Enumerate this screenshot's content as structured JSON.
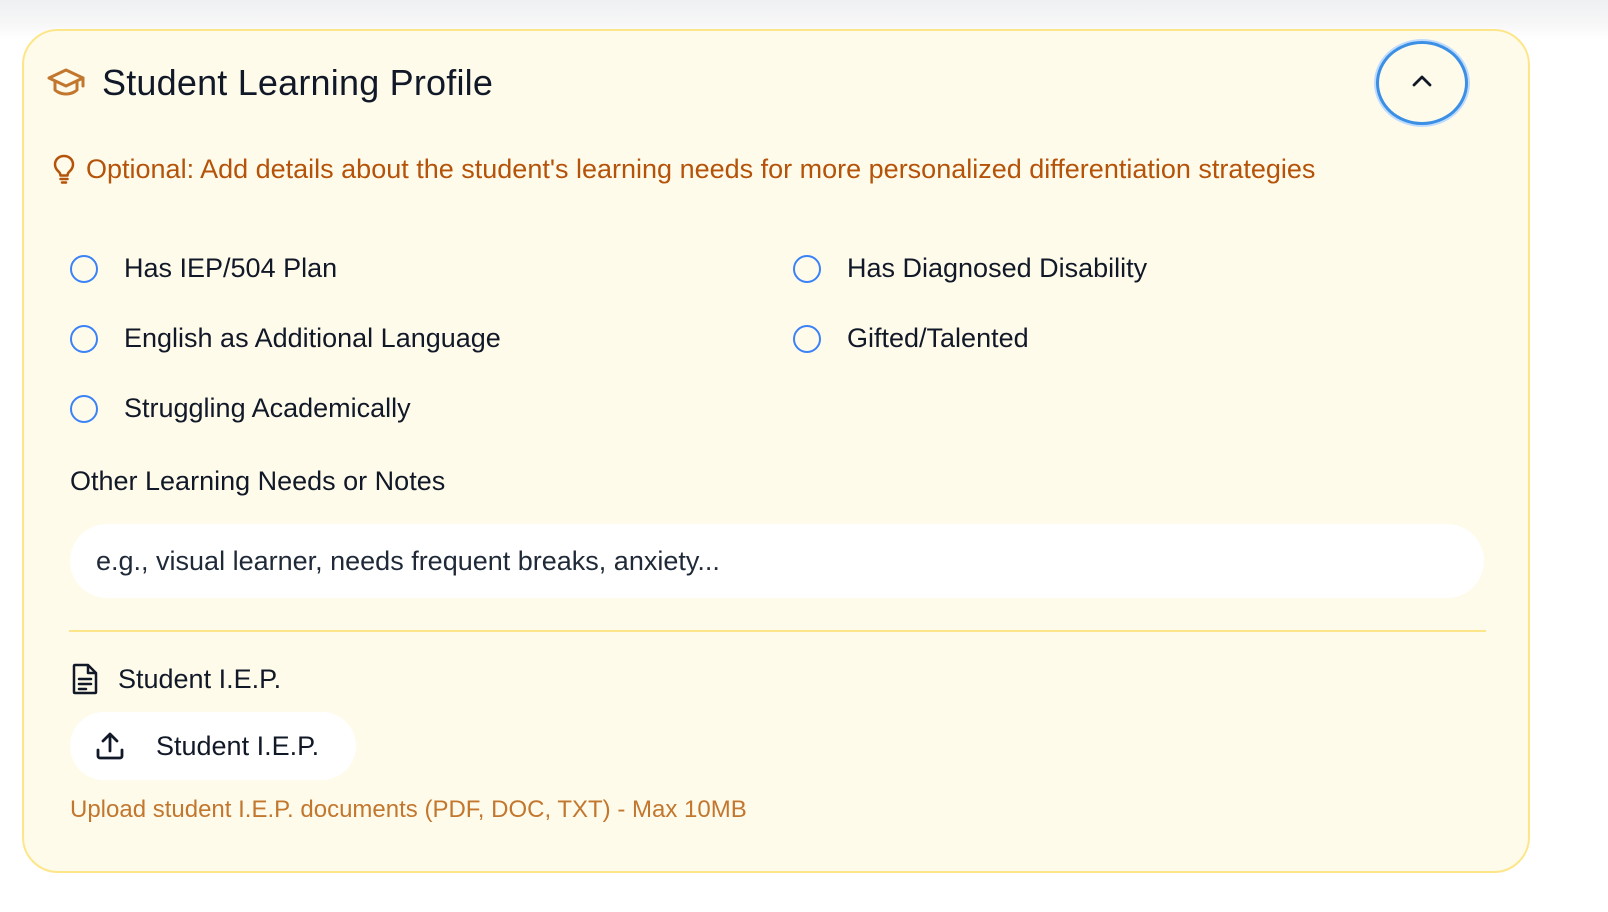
{
  "profile": {
    "title": "Student Learning Profile",
    "hint": "Optional: Add details about the student's learning needs for more personalized differentiation strategies",
    "checkboxes": [
      {
        "label": "Has IEP/504 Plan",
        "checked": false
      },
      {
        "label": "Has Diagnosed Disability",
        "checked": false
      },
      {
        "label": "English as Additional Language",
        "checked": false
      },
      {
        "label": "Gifted/Talented",
        "checked": false
      },
      {
        "label": "Struggling Academically",
        "checked": false
      }
    ],
    "notes": {
      "label": "Other Learning Needs or Notes",
      "placeholder": "e.g., visual learner, needs frequent breaks, anxiety...",
      "value": ""
    },
    "iep": {
      "section_title": "Student I.E.P.",
      "upload_label": "Student I.E.P.",
      "help": "Upload student I.E.P. documents (PDF, DOC, TXT) - Max 10MB"
    }
  },
  "icons": {
    "header": "graduation-cap-icon",
    "collapse": "chevron-up-icon",
    "hint": "lightbulb-icon",
    "iep": "file-text-icon",
    "upload": "upload-icon"
  },
  "colors": {
    "card_bg": "#fffbeb",
    "card_border": "#fde68a",
    "accent_orange": "#b45309",
    "focus_blue": "#3b82f6"
  }
}
